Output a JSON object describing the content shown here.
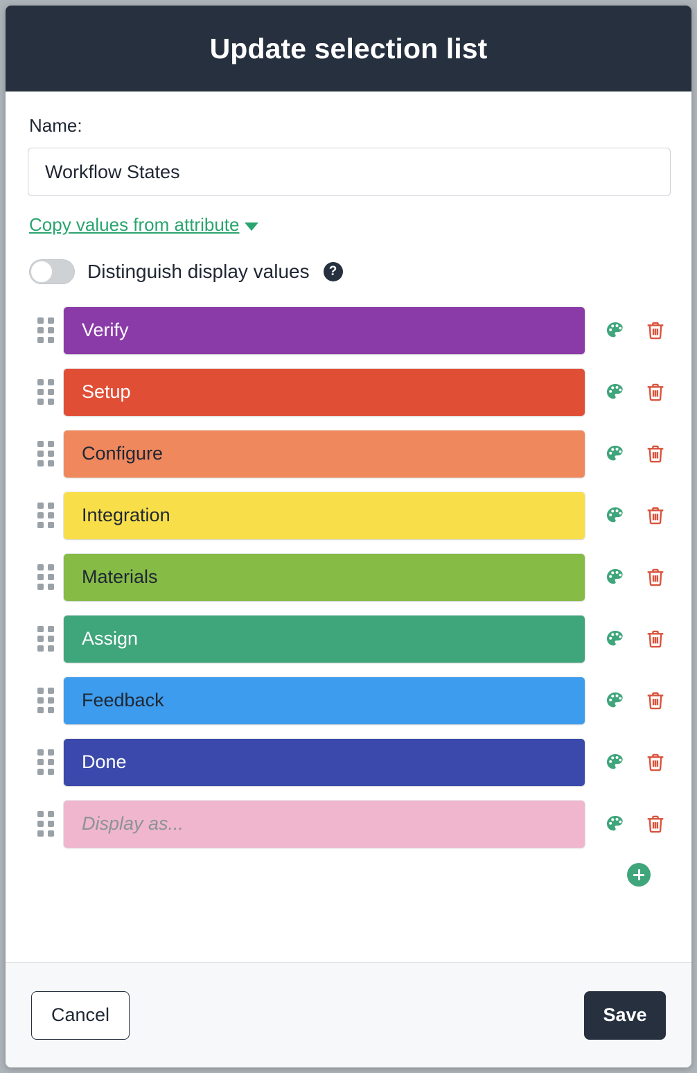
{
  "dialog": {
    "title": "Update selection list"
  },
  "form": {
    "name_label": "Name:",
    "name_value": "Workflow States",
    "name_placeholder": "",
    "copy_values_link": "Copy values from attribute",
    "toggle_label": "Distinguish display values",
    "toggle_on": false,
    "help_glyph": "?"
  },
  "colors": {
    "header_bg": "#26303f",
    "accent_green": "#2aa46f",
    "icon_palette": "#3fa57b",
    "icon_trash": "#d9533c",
    "add_button": "#3fa57b",
    "footer_bg": "#f6f8f9"
  },
  "values": [
    {
      "label": "Verify",
      "color": "#8a3ba8",
      "text_color": "#ffffff",
      "placeholder": ""
    },
    {
      "label": "Setup",
      "color": "#e04e36",
      "text_color": "#ffffff",
      "placeholder": ""
    },
    {
      "label": "Configure",
      "color": "#f0885e",
      "text_color": "#1f2733",
      "placeholder": ""
    },
    {
      "label": "Integration",
      "color": "#f8df4a",
      "text_color": "#1f2733",
      "placeholder": ""
    },
    {
      "label": "Materials",
      "color": "#86bb46",
      "text_color": "#1f2733",
      "placeholder": ""
    },
    {
      "label": "Assign",
      "color": "#3fa57b",
      "text_color": "#ffffff",
      "placeholder": ""
    },
    {
      "label": "Feedback",
      "color": "#3d9ced",
      "text_color": "#1f2733",
      "placeholder": ""
    },
    {
      "label": "Done",
      "color": "#3a49ab",
      "text_color": "#ffffff",
      "placeholder": ""
    },
    {
      "label": "",
      "color": "#efb6ce",
      "text_color": "#1f2733",
      "placeholder": "Display as..."
    }
  ],
  "row_actions": {
    "color_icon": "palette-icon",
    "delete_icon": "trash-icon"
  },
  "add_button_label": "+",
  "footer": {
    "cancel_label": "Cancel",
    "save_label": "Save"
  }
}
